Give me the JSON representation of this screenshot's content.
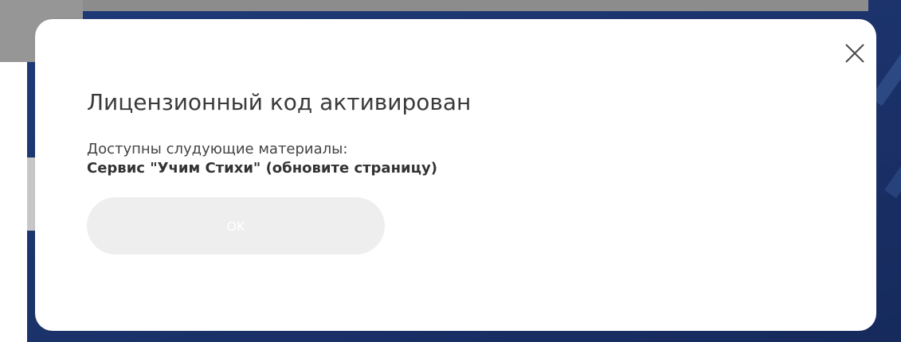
{
  "modal": {
    "title": "Лицензионный код активирован",
    "message_line1": "Доступны слудующие материалы:",
    "message_line2": "Сервис \"Учим Стихи\" (обновите страницу)",
    "ok_label": "OK",
    "close_icon": "close-icon"
  },
  "colors": {
    "backdrop": "#1b326a",
    "modal_bg": "#ffffff",
    "button_bg": "#eeeeee",
    "button_text": "#ffffff",
    "title_text": "#3a3a3a"
  }
}
